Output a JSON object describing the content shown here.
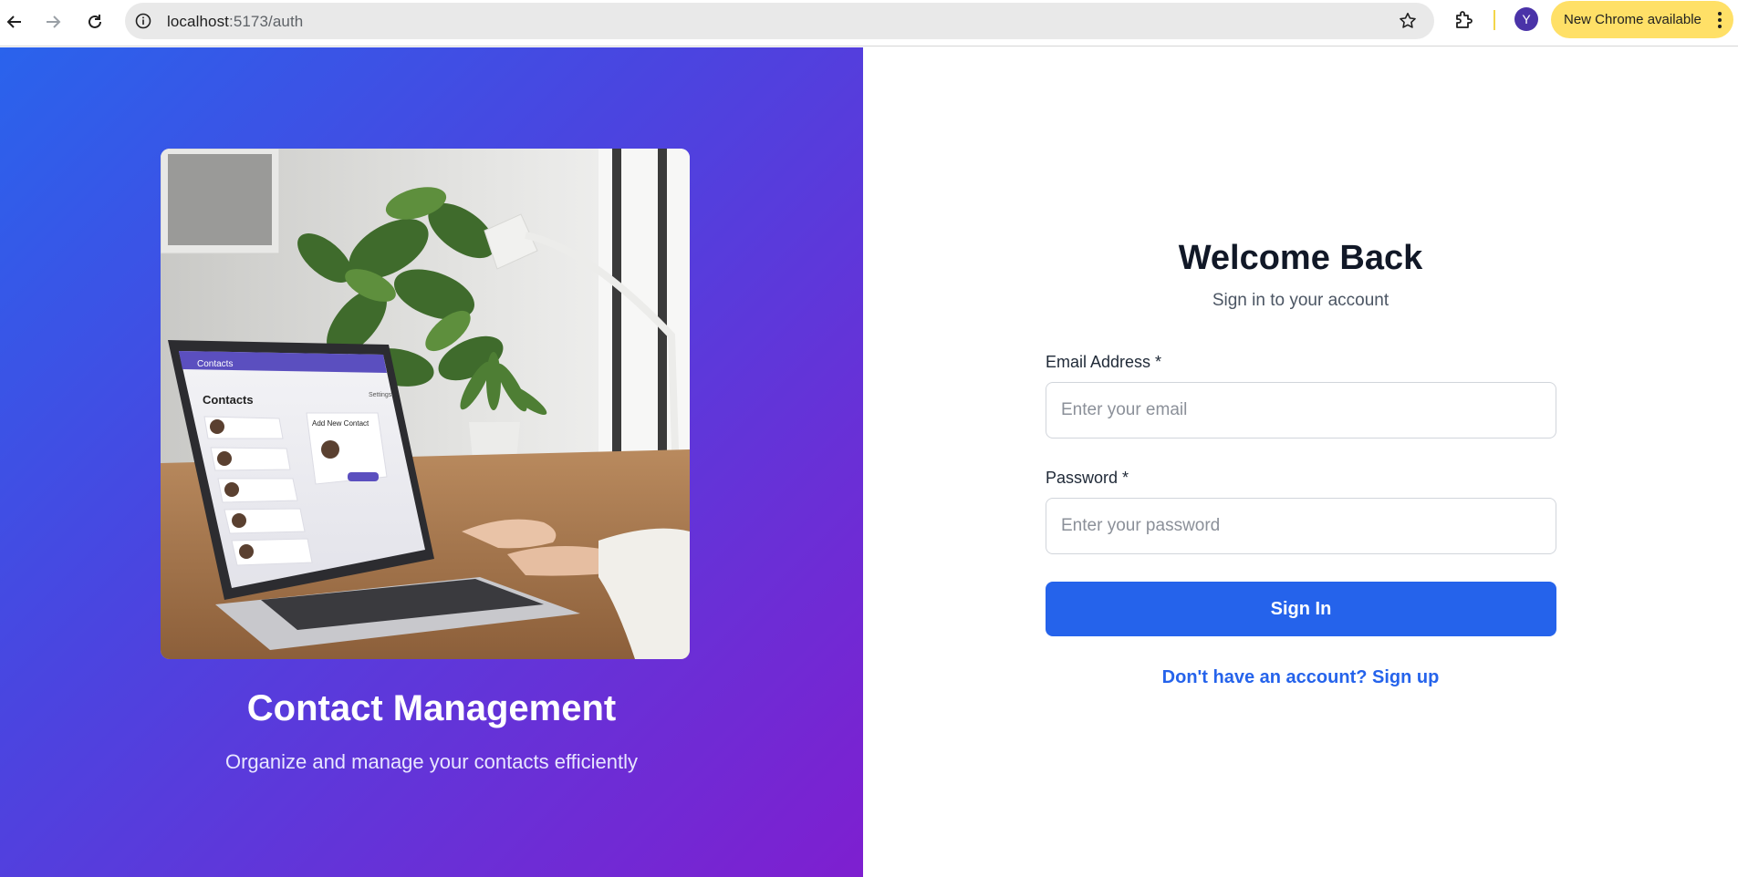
{
  "browser": {
    "url_host": "localhost",
    "url_path": ":5173/auth",
    "profile_initial": "Y",
    "update_chip_label": "New Chrome available",
    "icons": [
      "back-arrow-icon",
      "forward-arrow-icon",
      "reload-icon",
      "info-icon",
      "star-icon",
      "extensions-icon",
      "more-vert-icon"
    ]
  },
  "hero": {
    "title": "Contact Management",
    "subtitle": "Organize and manage your contacts efficiently",
    "image": {
      "screen_header": "Contacts",
      "list_heading": "Contacts",
      "settings_label": "Settings",
      "form_heading": "Add New Contact"
    }
  },
  "auth": {
    "title": "Welcome Back",
    "subtitle": "Sign in to your account",
    "email_label": "Email Address *",
    "email_placeholder": "Enter your email",
    "password_label": "Password *",
    "password_placeholder": "Enter your password",
    "submit_label": "Sign In",
    "signup_link": "Don't have an account? Sign up"
  },
  "colors": {
    "primary": "#2563eb",
    "hero_gradient_start": "#2a63ec",
    "hero_gradient_end": "#7e1fd0",
    "update_chip": "#ffe067"
  }
}
